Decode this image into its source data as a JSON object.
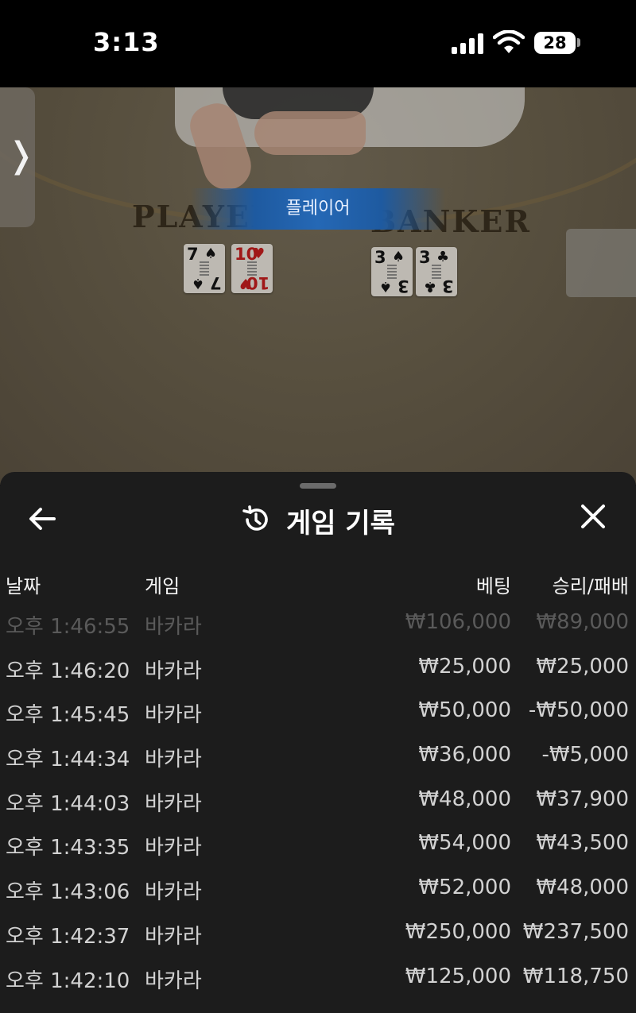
{
  "status_bar": {
    "time": "3:13",
    "battery": "28"
  },
  "video": {
    "table_label_player": "PLAYER",
    "table_label_banker": "BANKER",
    "result_banner": "플레이어",
    "player_cards": [
      {
        "rank": "7",
        "suit": "♠",
        "color": "black"
      },
      {
        "rank": "10",
        "suit": "♥",
        "color": "red"
      }
    ],
    "banker_cards": [
      {
        "rank": "3",
        "suit": "♠",
        "color": "black"
      },
      {
        "rank": "3",
        "suit": "♣",
        "color": "black"
      }
    ],
    "side_tab_icon": "chevron-right-icon"
  },
  "sheet": {
    "title": "게임 기록",
    "icons": {
      "back": "arrow-left-icon",
      "close": "close-icon",
      "history": "history-icon"
    },
    "columns": {
      "date": "날짜",
      "game": "게임",
      "bet": "베팅",
      "win_loss": "승리/패배"
    },
    "rows": [
      {
        "time": "오후 1:46:55",
        "game": "바카라",
        "bet": "₩106,000",
        "result": "₩89,000"
      },
      {
        "time": "오후 1:46:20",
        "game": "바카라",
        "bet": "₩25,000",
        "result": "₩25,000"
      },
      {
        "time": "오후 1:45:45",
        "game": "바카라",
        "bet": "₩50,000",
        "result": "-₩50,000"
      },
      {
        "time": "오후 1:44:34",
        "game": "바카라",
        "bet": "₩36,000",
        "result": "-₩5,000"
      },
      {
        "time": "오후 1:44:03",
        "game": "바카라",
        "bet": "₩48,000",
        "result": "₩37,900"
      },
      {
        "time": "오후 1:43:35",
        "game": "바카라",
        "bet": "₩54,000",
        "result": "₩43,500"
      },
      {
        "time": "오후 1:43:06",
        "game": "바카라",
        "bet": "₩52,000",
        "result": "₩48,000"
      },
      {
        "time": "오후 1:42:37",
        "game": "바카라",
        "bet": "₩250,000",
        "result": "₩237,500"
      },
      {
        "time": "오후 1:42:10",
        "game": "바카라",
        "bet": "₩125,000",
        "result": "₩118,750"
      }
    ]
  }
}
